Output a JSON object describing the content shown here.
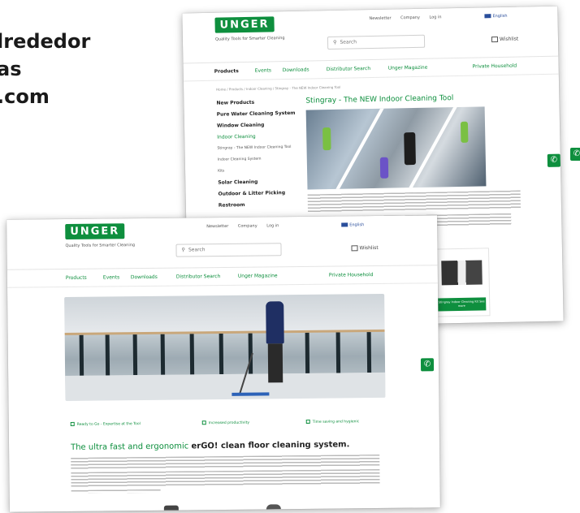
{
  "headline": {
    "lines": [
      "lrededor",
      "as",
      ".com"
    ]
  },
  "back_shot": {
    "logo": "UNGER",
    "logo_tagline": "Quality Tools for Smarter Cleaning",
    "top_links": [
      "Newsletter",
      "Company",
      "Log in"
    ],
    "language": "English",
    "search_placeholder": "Search",
    "wishlist_label": "Wishlist",
    "nav": [
      "Products",
      "Events",
      "Downloads",
      "Distributor Search",
      "Unger Magazine",
      "Private Household"
    ],
    "breadcrumb": "Home / Products / Indoor Cleaning / Stingray - The NEW Indoor Cleaning Tool",
    "sidebar": [
      {
        "label": "New Products",
        "style": "b"
      },
      {
        "label": "Pure Water Cleaning System",
        "style": "b"
      },
      {
        "label": "Window Cleaning",
        "style": "b"
      },
      {
        "label": "Indoor Cleaning",
        "style": "g"
      },
      {
        "label": "Stingray - The NEW Indoor Cleaning Tool",
        "style": "s"
      },
      {
        "label": "Indoor Cleaning System",
        "style": "s"
      },
      {
        "label": "Kits",
        "style": "s"
      },
      {
        "label": "Solar Cleaning",
        "style": "b"
      },
      {
        "label": "Outdoor & Litter Picking",
        "style": "b"
      },
      {
        "label": "Restroom",
        "style": "b"
      }
    ],
    "page_title": "Stingray - The NEW Indoor Cleaning Tool",
    "tile_button": "Stingray Indoor Cleaning Kit\nSee more"
  },
  "front_shot": {
    "logo": "UNGER",
    "logo_tagline": "Quality Tools for Smarter Cleaning",
    "top_links": [
      "Newsletter",
      "Company",
      "Log in"
    ],
    "language": "English",
    "search_placeholder": "Search",
    "wishlist_label": "Wishlist",
    "nav": [
      "Products",
      "Events",
      "Downloads",
      "Distributor Search",
      "Unger Magazine",
      "Private Household"
    ],
    "features": [
      "Ready to Go - Expertise at the Tool",
      "Increased productivity",
      "Time saving and hygienic"
    ],
    "headline_green": "The ultra fast and ergonomic",
    "headline_dark": "erGO! clean floor cleaning system."
  },
  "colors": {
    "brand_green": "#0e8f3e",
    "link_blue": "#2a4e9b"
  },
  "icons": {
    "phone": "phone-icon",
    "search": "search-icon",
    "wishlist": "wishlist-icon"
  }
}
